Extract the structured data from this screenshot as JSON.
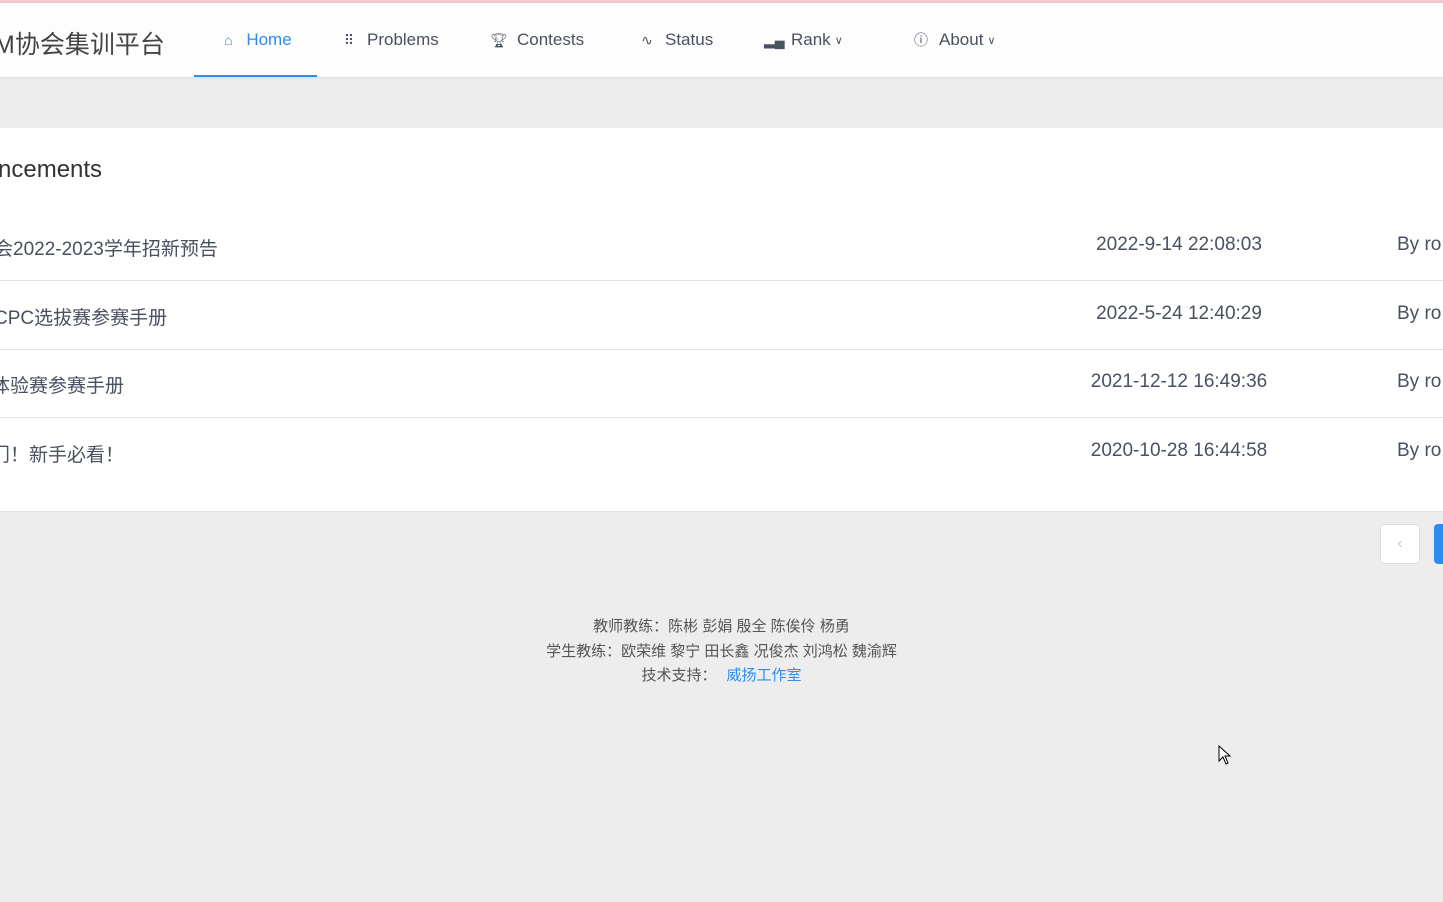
{
  "header": {
    "logo": "M协会集训平台",
    "nav": [
      {
        "label": "Home",
        "icon": "home-icon",
        "active": true
      },
      {
        "label": "Problems",
        "icon": "grid-icon"
      },
      {
        "label": "Contests",
        "icon": "trophy-icon"
      },
      {
        "label": "Status",
        "icon": "pulse-icon"
      },
      {
        "label": "Rank",
        "icon": "bar-chart-icon",
        "dropdown": true
      },
      {
        "label": "About",
        "icon": "info-icon",
        "dropdown": true
      }
    ]
  },
  "announcements": {
    "title": "ncements",
    "items": [
      {
        "title": "会2022-2023学年招新预告",
        "date": "2022-9-14 22:08:03",
        "by": "By ro"
      },
      {
        "title": "CPC选拔赛参赛手册",
        "date": "2022-5-24 12:40:29",
        "by": "By ro"
      },
      {
        "title": "体验赛参赛手册",
        "date": "2021-12-12 16:49:36",
        "by": "By ro"
      },
      {
        "title": "门！新手必看！",
        "date": "2020-10-28 16:44:58",
        "by": "By ro"
      }
    ]
  },
  "pagination": {
    "prev": "‹",
    "accent": "#2d8cf0"
  },
  "footer": {
    "teachers": "教师教练：陈彬 彭娟 殷全 陈俟伶 杨勇",
    "students": "学生教练：欧荣维 黎宁 田长鑫 况俊杰 刘鸿松 魏渝辉",
    "support_label": "技术支持：",
    "support_link": "威扬工作室"
  }
}
